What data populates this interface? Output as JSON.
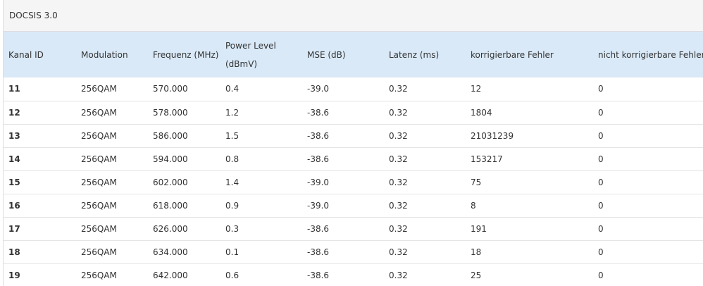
{
  "panel": {
    "title": "DOCSIS 3.0"
  },
  "table": {
    "headers": {
      "kanal_id": "Kanal ID",
      "modulation": "Modulation",
      "frequenz": "Frequenz (MHz)",
      "power_level_line1": "Power Level",
      "power_level_line2": "(dBmV)",
      "mse": "MSE (dB)",
      "latenz": "Latenz (ms)",
      "korrigierbare": "korrigierbare Fehler",
      "nicht_korrigierbare": "nicht korrigierbare Fehler"
    },
    "rows": [
      {
        "kanal": "11",
        "modulation": "256QAM",
        "frequenz": "570.000",
        "power": "0.4",
        "mse": "-39.0",
        "latenz": "0.32",
        "korr": "12",
        "nicht_korr": "0"
      },
      {
        "kanal": "12",
        "modulation": "256QAM",
        "frequenz": "578.000",
        "power": "1.2",
        "mse": "-38.6",
        "latenz": "0.32",
        "korr": "1804",
        "nicht_korr": "0"
      },
      {
        "kanal": "13",
        "modulation": "256QAM",
        "frequenz": "586.000",
        "power": "1.5",
        "mse": "-38.6",
        "latenz": "0.32",
        "korr": "21031239",
        "nicht_korr": "0"
      },
      {
        "kanal": "14",
        "modulation": "256QAM",
        "frequenz": "594.000",
        "power": "0.8",
        "mse": "-38.6",
        "latenz": "0.32",
        "korr": "153217",
        "nicht_korr": "0"
      },
      {
        "kanal": "15",
        "modulation": "256QAM",
        "frequenz": "602.000",
        "power": "1.4",
        "mse": "-39.0",
        "latenz": "0.32",
        "korr": "75",
        "nicht_korr": "0"
      },
      {
        "kanal": "16",
        "modulation": "256QAM",
        "frequenz": "618.000",
        "power": "0.9",
        "mse": "-39.0",
        "latenz": "0.32",
        "korr": "8",
        "nicht_korr": "0"
      },
      {
        "kanal": "17",
        "modulation": "256QAM",
        "frequenz": "626.000",
        "power": "0.3",
        "mse": "-38.6",
        "latenz": "0.32",
        "korr": "191",
        "nicht_korr": "0"
      },
      {
        "kanal": "18",
        "modulation": "256QAM",
        "frequenz": "634.000",
        "power": "0.1",
        "mse": "-38.6",
        "latenz": "0.32",
        "korr": "18",
        "nicht_korr": "0"
      },
      {
        "kanal": "19",
        "modulation": "256QAM",
        "frequenz": "642.000",
        "power": "0.6",
        "mse": "-38.6",
        "latenz": "0.32",
        "korr": "25",
        "nicht_korr": "0"
      }
    ]
  }
}
